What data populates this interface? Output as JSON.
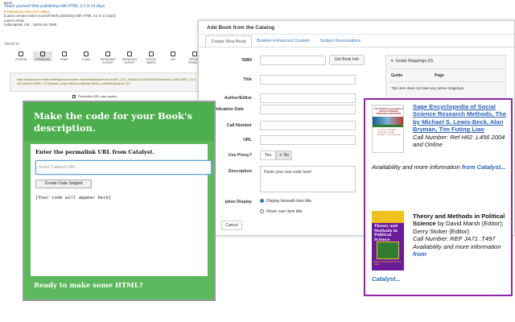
{
  "catalyst": {
    "record_line1": "Book",
    "record_title": "Teach yourself Web publishing with HTML 3.2 in 14 days",
    "record_line3": "Professional reference edition.",
    "record_line4": "[Laura Lemay's teach yourself Web publishing with HTML 3.2 in 14 days]",
    "record_author": "Laura Lemay",
    "record_pub": "Indianapolis, Ind. : Sams.net 1996",
    "send_to_label": "Send to",
    "send_items": [
      "CITATION",
      "PERMALINK",
      "PRINT",
      "E-MAIL",
      "REFWORKS EXPORT",
      "REFWORKS EXPORT",
      "EXPORT BIBTEX",
      "RIS",
      "REPORT PROBLEM"
    ],
    "permalink_url_line1": "https://catalyst-primo.hosted.exlibrisgroup.com/primo-explore/fulldisplay?docid=01BRC_CCO_ALMA21141162490002451&context=L&vid=01BRC_CCO",
    "permalink_url_line2": "led=1&docid=01BRC_CCO&search_scope=default_scope&tab=library_collections&lang=en_US",
    "permalink_copied": "Permalink URL was copied"
  },
  "dialog": {
    "title": "Add Book from the Catalog",
    "tabs": [
      "Create New Book",
      "Bowker Enhanced Content",
      "Subject Associations"
    ],
    "fields": {
      "isbn": "ISBN",
      "title": "Title",
      "author": "Author/Editor",
      "pub_date": "ublication Date",
      "call_number": "Call Number",
      "url": "URL",
      "use_proxy": "Use Proxy?",
      "description": "Description",
      "option_display": "ption Display"
    },
    "get_info_button": "Get Book Info",
    "proxy_yes": "Yes",
    "proxy_no": "✔ No",
    "description_placeholder": "Paste your new code here!",
    "radio_beneath": "Display beneath item title",
    "radio_hover": "Hover over item title",
    "cancel_button": "Cancel",
    "guide_mappings": {
      "heading": "Guide Mappings (0)",
      "col_guide": "Guide",
      "col_page": "Page",
      "empty": "This item does not have any active mappings."
    }
  },
  "codegen": {
    "title": "Make the code for your Book's description.",
    "prompt": "Enter the permalink URL from Catalyst.",
    "input_placeholder": "Enter Catalyst URL...",
    "create_button": "Create Code Snippet",
    "output_placeholder": "[Your code will appear here]",
    "footer": "Ready to make some HTML?"
  },
  "books": {
    "book1": {
      "cover_series": "The SAGE Encyclopedia of",
      "cover_title": "SOCIAL SCIENCE RESEARCH METHODS",
      "cover_lines": "VOLUME 1 / MICHAEL S. LEWIS-BECK / ALAN BRYMAN / TIM FUTING LIAO",
      "title_link": "Sage Encyclopedia of Social Science Research Methods, The by Michael S. Lewis-Beck, Alan Bryman, Tim Futing Liao",
      "call_number": "Call Number: Ref H62 .L456 2004 and Online",
      "availability": "Availability and more information",
      "from_catalyst": "from Catalyst..."
    },
    "book2": {
      "cover_title": "Theory and Methods in Political Science",
      "cover_foot": "Edited by David Marsh and Gerry Stoker",
      "title": "Theory and Methods in Political Science",
      "authors": "by David Marsh (Editor); Gerry Stoker (Editor)",
      "call_number": "Call Number: REF JA71 .T497",
      "availability": "Availability and more information",
      "from": "from",
      "catalyst": "Catalyst..."
    }
  },
  "colors": {
    "green": "#5cb85c",
    "purple": "#8e24aa",
    "link_blue": "#2a62b8"
  }
}
